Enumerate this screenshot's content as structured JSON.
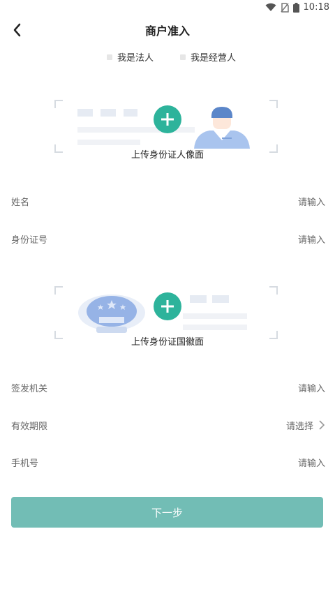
{
  "status_bar": {
    "time": "10:18"
  },
  "header": {
    "title": "商户准入"
  },
  "roles": [
    {
      "label": "我是法人"
    },
    {
      "label": "我是经营人"
    }
  ],
  "upload_front": {
    "label": "上传身份证人像面"
  },
  "upload_back": {
    "label": "上传身份证国徽面"
  },
  "fields": {
    "name": {
      "label": "姓名",
      "placeholder": "请输入"
    },
    "id_number": {
      "label": "身份证号",
      "placeholder": "请输入"
    },
    "issuer": {
      "label": "签发机关",
      "placeholder": "请输入"
    },
    "validity": {
      "label": "有效期限",
      "placeholder": "请选择"
    },
    "phone": {
      "label": "手机号",
      "placeholder": "请输入"
    }
  },
  "next_button": {
    "label": "下一步"
  },
  "colors": {
    "accent": "#2db39b",
    "button": "#72bdb5"
  }
}
